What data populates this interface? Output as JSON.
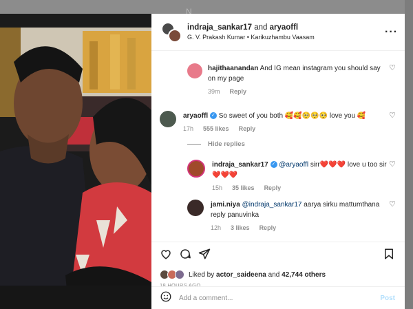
{
  "backdrop": {
    "text": "N"
  },
  "header": {
    "user1": "indraja_sankar17",
    "and_text": "and",
    "user2": "aryaoffl",
    "location": "G. V. Prakash Kumar • Karikuzhambu Vaasam",
    "more_icon": "more-horizontal-icon"
  },
  "comments": [
    {
      "user": "hajithaanandan",
      "text": "And IG mean instagram you should say on my page",
      "time": "39m",
      "reply": "Reply"
    },
    {
      "user": "aryaoffl",
      "text": "So sweet of you both 🥰🥰🥺🥺🥺 love you 🥰",
      "time": "17h",
      "likes": "555 likes",
      "reply": "Reply"
    },
    {
      "user": "indraja_sankar17",
      "mention": "@aryaoffl",
      "text": "sirr❤️❤️❤️ love u too sir❤️❤️❤️",
      "time": "15h",
      "likes": "35 likes",
      "reply": "Reply"
    },
    {
      "user": "jami.niya",
      "mention": "@indraja_sankar17",
      "text": "aarya sirku mattumthana reply panuvinka",
      "time": "12h",
      "likes": "3 likes",
      "reply": "Reply"
    }
  ],
  "hide_replies": "Hide replies",
  "likes": {
    "prefix": "Liked by",
    "user": "actor_saideena",
    "and_text": "and",
    "count": "42,744 others"
  },
  "time_ago": "18 HOURS AGO",
  "add_comment": {
    "placeholder": "Add a comment...",
    "post_label": "Post"
  },
  "icons": [
    "heart-icon",
    "comment-icon",
    "share-icon",
    "bookmark-icon",
    "emoji-icon",
    "verified-icon"
  ],
  "colors": {
    "link": "#00376b",
    "muted": "#8e8e8e",
    "verified": "#3897f0",
    "post_disabled": "#b2dffc"
  }
}
